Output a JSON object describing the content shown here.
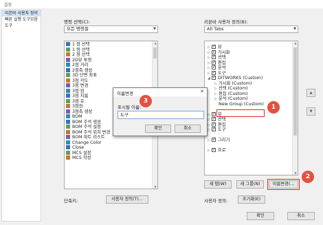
{
  "window": {
    "title": "설정"
  },
  "nav": {
    "items": [
      "리본바 사용자 정의",
      "빠른 실행 도구모음",
      "도구"
    ]
  },
  "left": {
    "label": "명령 선택(C):",
    "combo_value": "모든 명령들",
    "commands": [
      "1 점 선택",
      "1 점 선택",
      "2 점 선택",
      "2D뷰 투영",
      "2점 거리",
      "2점축 생성",
      "3D 단면 좌표",
      "3점 각도",
      "3점 변경",
      "3점 원",
      "3점 지름",
      "3점 호",
      "3점원",
      "3점축 생성",
      "BOM",
      "BOM 주석 생성",
      "BOM 주석 설정",
      "BOM 주석 위치 변경",
      "BOM 파트 리스트",
      "Change Color",
      "Close",
      "MCS 설정",
      "MCS 작성"
    ]
  },
  "right": {
    "label": "리본바 사용자 정의(B):",
    "combo_value": "All Tabs",
    "tree": [
      {
        "level": 0,
        "exp": "▷",
        "check": true,
        "text": "뷰"
      },
      {
        "level": 0,
        "exp": "▷",
        "check": true,
        "text": "가시화"
      },
      {
        "level": 0,
        "exp": "▷",
        "check": true,
        "text": "선택"
      },
      {
        "level": 0,
        "exp": "▷",
        "check": true,
        "text": "편집"
      },
      {
        "level": 0,
        "exp": "▷",
        "check": true,
        "text": "분석"
      },
      {
        "level": 0,
        "exp": "▷",
        "check": true,
        "text": "도구"
      },
      {
        "level": 0,
        "exp": "◢",
        "check": true,
        "text": "DITWORKS (Custom)"
      },
      {
        "level": 1,
        "exp": "▷",
        "check": null,
        "text": "가시화 (Custom)"
      },
      {
        "level": 1,
        "exp": "▷",
        "check": null,
        "text": "선택 (Custom)"
      },
      {
        "level": 1,
        "exp": "▷",
        "check": null,
        "text": "편집 (Custom)"
      },
      {
        "level": 1,
        "exp": "▷",
        "check": null,
        "text": "분석 (Custom)"
      },
      {
        "level": 1,
        "exp": "",
        "check": null,
        "text": "New Group (Custom)"
      },
      {
        "level": 0,
        "exp": "",
        "check": null,
        "text": ""
      },
      {
        "level": 0,
        "exp": "▷",
        "check": true,
        "text": "뷰"
      },
      {
        "level": 0,
        "exp": "▷",
        "check": true,
        "text": "선택"
      },
      {
        "level": 0,
        "exp": "▷",
        "check": true,
        "text": "편집"
      },
      {
        "level": 0,
        "exp": "▷",
        "check": true,
        "text": "도구"
      },
      {
        "level": 0,
        "exp": "",
        "check": null,
        "text": ""
      },
      {
        "level": 0,
        "exp": "▷",
        "check": true,
        "text": "그리기"
      },
      {
        "level": 0,
        "exp": "",
        "check": null,
        "text": ""
      },
      {
        "level": 0,
        "exp": "▷",
        "check": true,
        "text": "프로"
      }
    ],
    "new_tab": "새 탭(W)",
    "new_group": "새 그룹(N)",
    "rename": "이름변경(...",
    "user_def_label": "사용자 정의:",
    "reset": "초기화(E)"
  },
  "bottom": {
    "shortcut_label": "단축키:",
    "customize": "사용자 정의(T)...",
    "ok": "확인",
    "cancel": "취소"
  },
  "dialog": {
    "title": "이름변경",
    "field_label": "표시될 이름:",
    "value": "도구",
    "ok": "확인",
    "cancel": "취소",
    "close_glyph": "✕"
  },
  "badges": [
    "1",
    "2",
    "3"
  ],
  "colors": {
    "highlight": "#e0282e",
    "badge": "#e4513e",
    "selection": "#cfe3f7"
  }
}
